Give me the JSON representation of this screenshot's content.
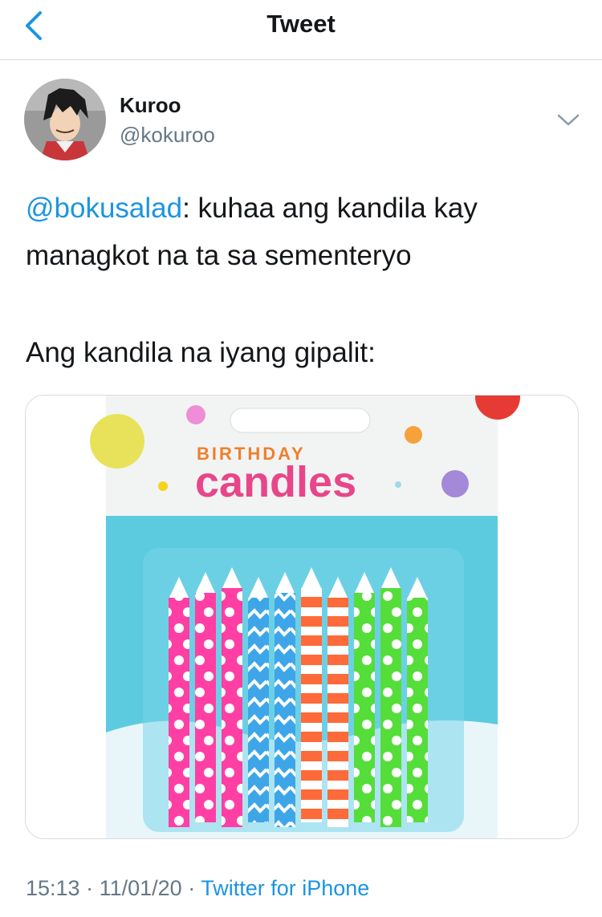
{
  "header": {
    "title": "Tweet"
  },
  "author": {
    "name": "Kuroo",
    "handle": "@kokuroo"
  },
  "tweet": {
    "mention": "@bokusalad",
    "line1_rest": ": kuhaa ang kandila kay managkot na ta sa sementeryo",
    "line2": "Ang kandila na iyang gipalit:"
  },
  "media": {
    "package_title_top": "BIRTHDAY",
    "package_title_bottom": "candles",
    "candles": [
      {
        "color": "#ff3fa4",
        "pattern": "dots"
      },
      {
        "color": "#ff3fa4",
        "pattern": "dots"
      },
      {
        "color": "#ff3fa4",
        "pattern": "dots"
      },
      {
        "color": "#3ea6e8",
        "pattern": "zigzag"
      },
      {
        "color": "#3ea6e8",
        "pattern": "zigzag"
      },
      {
        "color": "#ff6a3a",
        "pattern": "stripes"
      },
      {
        "color": "#ff6a3a",
        "pattern": "stripes"
      },
      {
        "color": "#55dd3a",
        "pattern": "dots"
      },
      {
        "color": "#55dd3a",
        "pattern": "dots"
      },
      {
        "color": "#55dd3a",
        "pattern": "dots"
      }
    ]
  },
  "meta": {
    "time": "15:13",
    "sep1": " · ",
    "date": "11/01/20",
    "sep2": " · ",
    "source": "Twitter for iPhone"
  },
  "colors": {
    "link": "#1b95e0",
    "secondary": "#657786"
  }
}
